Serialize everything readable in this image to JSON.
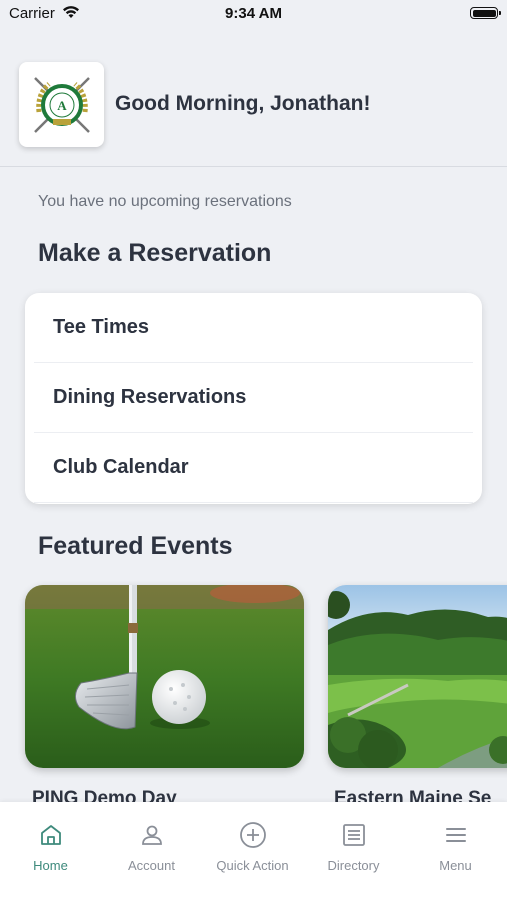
{
  "status_bar": {
    "carrier": "Carrier",
    "time": "9:34 AM"
  },
  "header": {
    "greeting": "Good Morning, Jonathan!",
    "logo_icon": "club-crest-logo"
  },
  "reservations": {
    "empty_message": "You have no upcoming reservations",
    "title": "Make a Reservation",
    "items": [
      {
        "label": "Tee Times"
      },
      {
        "label": "Dining Reservations"
      },
      {
        "label": "Club Calendar"
      }
    ]
  },
  "events": {
    "title": "Featured Events",
    "items": [
      {
        "label": "PING Demo Day",
        "image": "golf-club-and-ball-image"
      },
      {
        "label": "Eastern Maine Se",
        "image": "golf-course-landscape-image"
      }
    ]
  },
  "tabs": [
    {
      "label": "Home",
      "icon": "home-icon",
      "active": true
    },
    {
      "label": "Account",
      "icon": "person-icon",
      "active": false
    },
    {
      "label": "Quick Action",
      "icon": "plus-circle-icon",
      "active": false
    },
    {
      "label": "Directory",
      "icon": "list-icon",
      "active": false
    },
    {
      "label": "Menu",
      "icon": "hamburger-icon",
      "active": false
    }
  ],
  "colors": {
    "accent": "#3e8a7c",
    "background": "#eef0f4",
    "text": "#2d3340",
    "muted": "#8a8f98"
  }
}
